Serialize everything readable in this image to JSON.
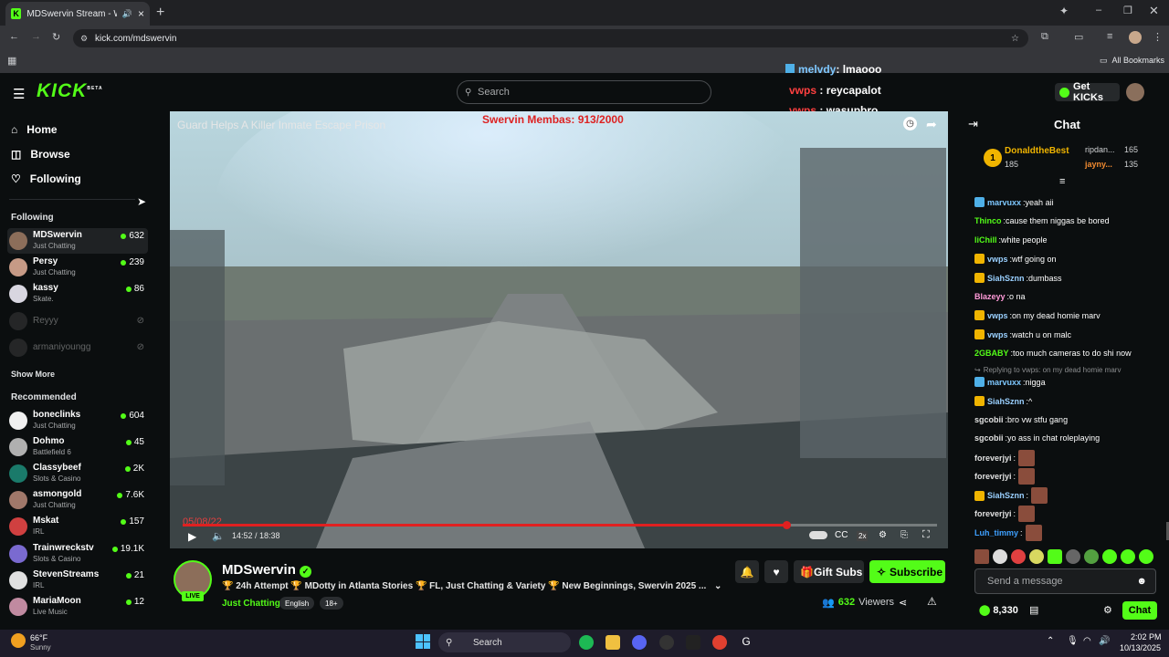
{
  "browser": {
    "tab_title": "MDSwervin Stream - Watch",
    "url": "kick.com/mdswervin",
    "bookmarks_label": "All Bookmarks"
  },
  "header": {
    "logo": "KICK",
    "logo_badge": "BETA",
    "search_placeholder": "Search",
    "get_kicks": "Get KICKs"
  },
  "overlay_chat": [
    {
      "user": "melvdy",
      "text": ": lmaooo",
      "color": "#7ec8ff"
    },
    {
      "user": "vwps",
      "text": ": reycapalot",
      "color": "#ff4040"
    },
    {
      "user": "vwps",
      "text": ": wasupbro",
      "color": "#ff4040"
    }
  ],
  "sidebar": {
    "nav": [
      {
        "label": "Home"
      },
      {
        "label": "Browse"
      },
      {
        "label": "Following"
      }
    ],
    "following_header": "Following",
    "following": [
      {
        "name": "MDSwervin",
        "category": "Just Chatting",
        "viewers": "632",
        "live": true
      },
      {
        "name": "Persy",
        "category": "Just Chatting",
        "viewers": "239",
        "live": true
      },
      {
        "name": "kassy",
        "category": "Skate.",
        "viewers": "86",
        "live": true
      },
      {
        "name": "Reyyy",
        "category": "",
        "viewers": "",
        "live": false
      },
      {
        "name": "armaniyoungg",
        "category": "",
        "viewers": "",
        "live": false
      }
    ],
    "show_more": "Show More",
    "recommended_header": "Recommended",
    "recommended": [
      {
        "name": "boneclinks",
        "category": "Just Chatting",
        "viewers": "604"
      },
      {
        "name": "Dohmo",
        "category": "Battlefield 6",
        "viewers": "45"
      },
      {
        "name": "Classybeef",
        "category": "Slots & Casino",
        "viewers": "2K"
      },
      {
        "name": "asmongold",
        "category": "Just Chatting",
        "viewers": "7.6K"
      },
      {
        "name": "Mskat",
        "category": "IRL",
        "viewers": "157"
      },
      {
        "name": "Trainwreckstv",
        "category": "Slots & Casino",
        "viewers": "19.1K"
      },
      {
        "name": "StevenStreams",
        "category": "IRL",
        "viewers": "21"
      },
      {
        "name": "MariaMoon",
        "category": "Live Music",
        "viewers": "12"
      }
    ]
  },
  "video": {
    "title": "Guard Helps A Killer Inmate Escape Prison",
    "overlay_text": "Swervin Membas: 913/2000",
    "dashcam_date": "05/08/22",
    "time": "14:52 / 18:38",
    "progress": 0.8,
    "speed": "2x"
  },
  "stream": {
    "channel_name": "MDSwervin",
    "live_label": "LIVE",
    "title": "🏆 24h Attempt 🏆 MDotty in Atlanta Stories 🏆 FL, Just Chatting & Variety 🏆 New Beginnings, Swervin 2025 ...",
    "category": "Just Chatting",
    "tags": [
      "English",
      "18+"
    ],
    "gift_subs": "Gift Subs",
    "subscribe": "Subscribe",
    "viewers": "632",
    "viewers_label": "Viewers"
  },
  "chat": {
    "header": "Chat",
    "pinned": [
      {
        "rank": "1",
        "name": "DonaldtheBest",
        "amount": "185"
      },
      {
        "name": "ripdan...",
        "amount": "165"
      },
      {
        "name": "jayny...",
        "amount": "135"
      }
    ],
    "messages": [
      {
        "user": "marvuxx",
        "color": "#7ec8ff",
        "text": "yeah aii",
        "badge": "#4fb0e8"
      },
      {
        "user": "Thinco",
        "color": "#53fc18",
        "text": "cause them niggas be bored",
        "badge": ""
      },
      {
        "user": "liChill",
        "color": "#53fc18",
        "text": "white people",
        "badge": ""
      },
      {
        "user": "vwps",
        "color": "#9ad0ff",
        "text": "wtf going on",
        "badge": "#f0b400"
      },
      {
        "user": "SiahSznn",
        "color": "#9ad0ff",
        "text": "dumbass",
        "badge": "#f0b400"
      },
      {
        "user": "Blazeyy",
        "color": "#ff9ad8",
        "text": "o na",
        "badge": ""
      },
      {
        "user": "vwps",
        "color": "#9ad0ff",
        "text": "on my dead homie marv",
        "badge": "#f0b400"
      },
      {
        "user": "vwps",
        "color": "#9ad0ff",
        "text": "watch u on malc",
        "badge": "#f0b400"
      },
      {
        "user": "2GBABY",
        "color": "#53fc18",
        "text": "too much cameras to do shi now",
        "badge": ""
      },
      {
        "user": "marvuxx",
        "color": "#7ec8ff",
        "text": "nigga",
        "badge": "#4fb0e8"
      },
      {
        "user": "SiahSznn",
        "color": "#9ad0ff",
        "text": "^",
        "badge": "#f0b400"
      },
      {
        "user": "sgcobii",
        "color": "#e0e0e0",
        "text": "bro vw stfu gang",
        "badge": ""
      },
      {
        "user": "sgcobii",
        "color": "#e0e0e0",
        "text": "yo ass in chat roleplaying",
        "badge": ""
      },
      {
        "user": "foreverjyi",
        "color": "#e0e0e0",
        "text": "",
        "badge": ""
      },
      {
        "user": "foreverjyi",
        "color": "#e0e0e0",
        "text": "",
        "badge": ""
      },
      {
        "user": "SiahSznn",
        "color": "#9ad0ff",
        "text": "",
        "badge": "#f0b400"
      },
      {
        "user": "foreverjyi",
        "color": "#e0e0e0",
        "text": "",
        "badge": ""
      },
      {
        "user": "Luh_timmy",
        "color": "#3ea0ff",
        "text": "",
        "badge": ""
      }
    ],
    "reply_note": "Replying to vwps: on my dead homie marv",
    "input_placeholder": "Send a message",
    "points": "8,330",
    "send": "Chat"
  },
  "taskbar": {
    "weather_temp": "66°F",
    "weather_desc": "Sunny",
    "search": "Search",
    "time": "2:02 PM",
    "date": "10/13/2025"
  }
}
